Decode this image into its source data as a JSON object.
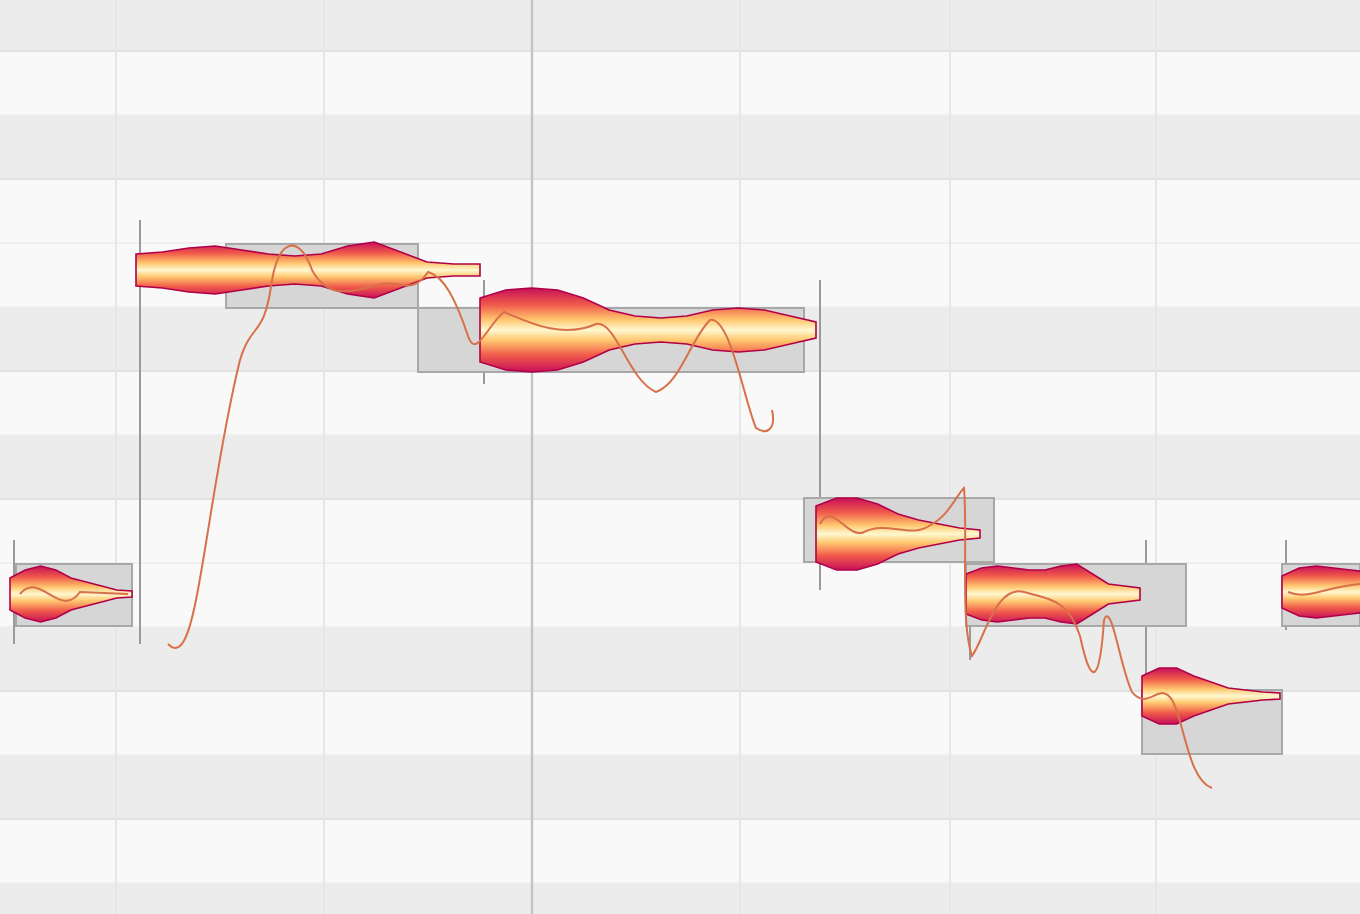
{
  "editor": {
    "notes": [
      {
        "kind": "blob",
        "selected": false
      },
      {
        "kind": "blob",
        "selected": false
      },
      {
        "kind": "blob",
        "selected": false
      },
      {
        "kind": "blob",
        "selected": false
      },
      {
        "kind": "blob",
        "selected": false
      },
      {
        "kind": "blob",
        "selected": false
      },
      {
        "kind": "blob",
        "selected": false
      }
    ]
  }
}
